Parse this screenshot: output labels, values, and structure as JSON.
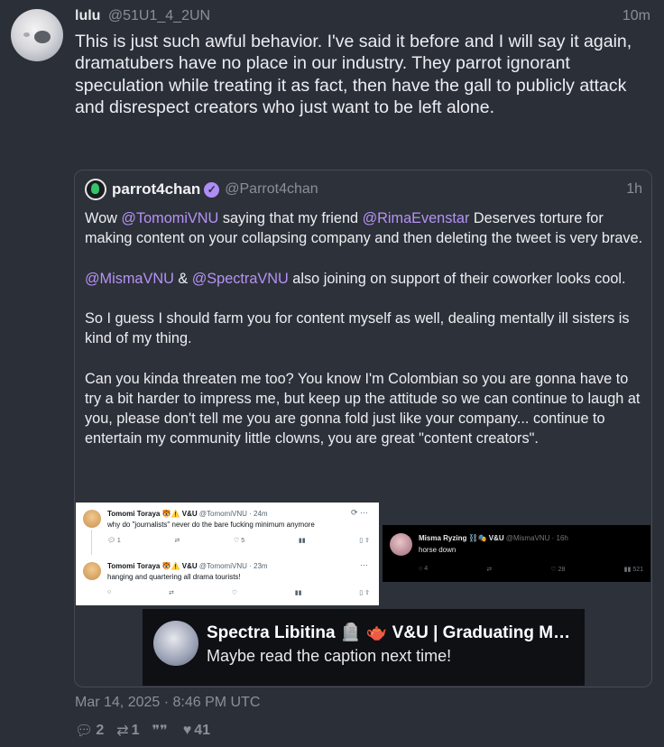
{
  "post": {
    "display_name": "lulu",
    "handle": "@51U1_4_2UN",
    "time": "10m",
    "text": "This is just such awful behavior. I've said it before and I will say it again, dramatubers have no place in our industry. They parrot ignorant speculation while treating it as fact, then have the gall to publicly attack and disrespect creators who just want to be left alone.",
    "date": "Mar 14, 2025 · 8:46 PM UTC",
    "stats": {
      "replies": "2",
      "reposts": "1",
      "quotes": "",
      "likes": "41"
    }
  },
  "quote": {
    "display_name": "parrot4chan",
    "handle": "@Parrot4chan",
    "time": "1h",
    "p1": {
      "a": "Wow ",
      "m1": "@TomomiVNU",
      "b": " saying that my friend ",
      "m2": "@RimaEvenstar",
      "c": " Deserves torture for making content on your collapsing company and then deleting the tweet is very brave."
    },
    "p2": {
      "m1": "@MismaVNU",
      "a": " & ",
      "m2": "@SpectraVNU",
      "b": " also joining on support of their coworker looks cool."
    },
    "p3": "So I guess I should farm you for content myself as well, dealing mentally ill sisters is kind of my thing.",
    "p4": "Can you kinda threaten me too? You know I'm Colombian so you are gonna have to try a bit harder to impress me, but keep up the attitude so we can continue to laugh at you, please don't tell me you are gonna fold just like your company... continue to entertain my community little clowns, you are great \"content creators\"."
  },
  "screenshot_tomomi": {
    "tweets": [
      {
        "name": "Tomomi Toraya 🐯⚠️ V&U",
        "handle": "@TomomiVNU · 24m",
        "text": "why do \"journalists\" never do the bare fucking minimum anymore",
        "replies": "1",
        "likes": "5"
      },
      {
        "name": "Tomomi Toraya 🐯⚠️ V&U",
        "handle": "@TomomiVNU · 23m",
        "text": "hanging and quartering all drama tourists!",
        "replies": "",
        "likes": ""
      }
    ]
  },
  "screenshot_misma": {
    "name": "Misma Ryzing ⛓️🎭 V&U",
    "handle": "@MismaVNU · 16h",
    "text": "horse down",
    "replies": "4",
    "likes": "28",
    "views": "521"
  },
  "screenshot_spectra": {
    "name": "Spectra Libitina 🪦 🫖 V&U | Graduating Marc...",
    "text": "Maybe read the caption next time!"
  }
}
